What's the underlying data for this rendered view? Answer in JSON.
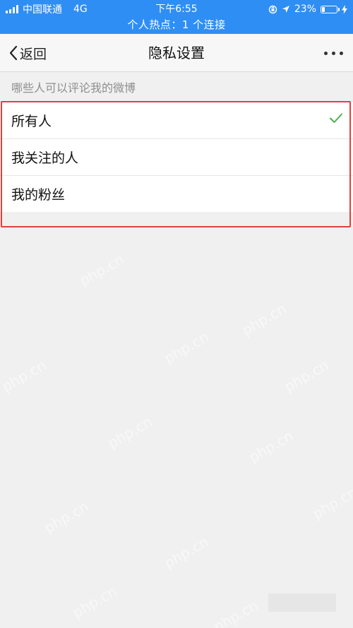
{
  "status_bar": {
    "carrier": "中国联通",
    "network": "4G",
    "time": "下午6:55",
    "battery_percent": "23%",
    "battery_level": 0.23,
    "hotspot_text": "个人热点：1 个连接",
    "background_color": "#2f8ef3"
  },
  "navbar": {
    "back_label": "返回",
    "title": "隐私设置",
    "more_icon": "more-dots-icon"
  },
  "section": {
    "label": "哪些人可以评论我的微博"
  },
  "options": [
    {
      "label": "所有人",
      "selected": true
    },
    {
      "label": "我关注的人",
      "selected": false
    },
    {
      "label": "我的粉丝",
      "selected": false
    }
  ],
  "colors": {
    "check": "#4caf50",
    "highlight": "#e0413b"
  },
  "watermark": "php.cn"
}
